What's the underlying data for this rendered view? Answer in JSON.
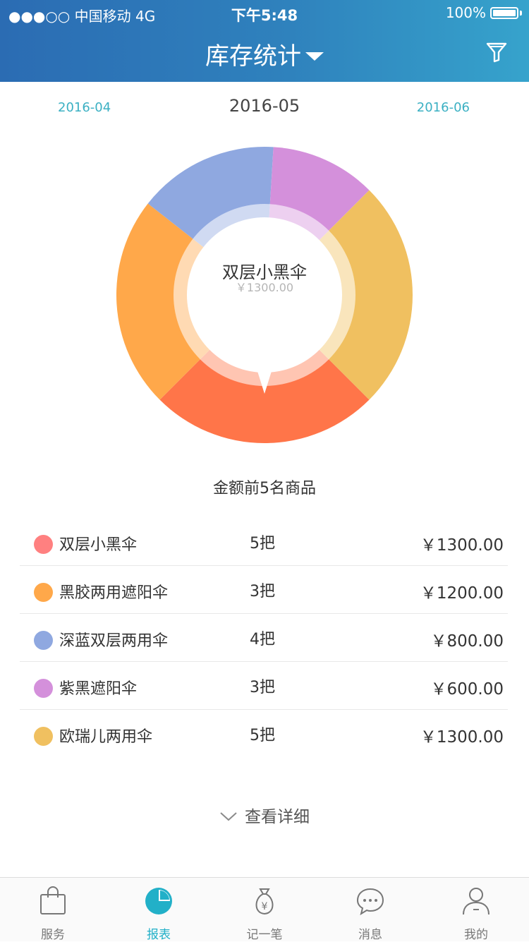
{
  "status_bar": {
    "carrier": "●●●○○ 中国移动   4G",
    "time": "下午5:48",
    "battery": "100%"
  },
  "nav": {
    "title": "库存统计",
    "filter_icon": "filter-icon"
  },
  "months": {
    "prev": "2016-04",
    "current": "2016-05",
    "next": "2016-06"
  },
  "chart_data": {
    "type": "pie",
    "categories": [
      "双层小黑伞",
      "黑胶两用遮阳伞",
      "深蓝双层两用伞",
      "紫黑遮阳伞",
      "欧瑞儿两用伞"
    ],
    "values": [
      1300.0,
      1200.0,
      800.0,
      600.0,
      1300.0
    ],
    "highlighted": {
      "name": "双层小黑伞",
      "amount": "￥1300.00"
    }
  },
  "caption": "金额前5名商品",
  "products": [
    {
      "name": "双层小黑伞",
      "qty": "5把",
      "price": "￥1300.00",
      "color": "#ff8080"
    },
    {
      "name": "黑胶两用遮阳伞",
      "qty": "3把",
      "price": "￥1200.00",
      "color": "#ffa84a"
    },
    {
      "name": "深蓝双层两用伞",
      "qty": "4把",
      "price": "￥800.00",
      "color": "#8fa8e0"
    },
    {
      "name": "紫黑遮阳伞",
      "qty": "3把",
      "price": "￥600.00",
      "color": "#d490db"
    },
    {
      "name": "欧瑞儿两用伞",
      "qty": "5把",
      "price": "￥1300.00",
      "color": "#f0c060"
    }
  ],
  "detail_link": "查看详细",
  "tabs": [
    {
      "label": "服务",
      "icon": "shopping-bag-icon"
    },
    {
      "label": "报表",
      "icon": "pie-chart-icon"
    },
    {
      "label": "记一笔",
      "icon": "money-bag-icon"
    },
    {
      "label": "消息",
      "icon": "chat-bubble-icon"
    },
    {
      "label": "我的",
      "icon": "person-icon"
    }
  ],
  "colors": {
    "accent": "#22b0c8",
    "header_start": "#2b6cb3",
    "header_end": "#36a3cc",
    "orange_segment": "#ff7549"
  }
}
